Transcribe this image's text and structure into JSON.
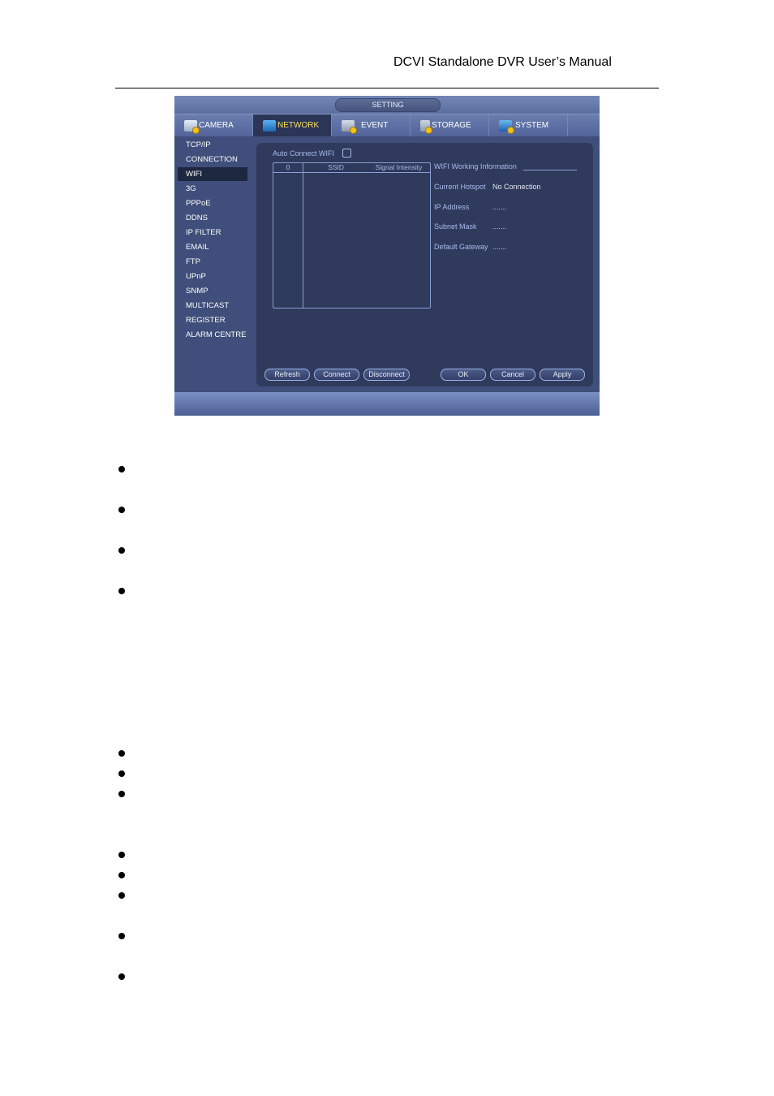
{
  "document": {
    "header": "DCVI Standalone DVR User’s Manual"
  },
  "window": {
    "title": "SETTING",
    "tabs": [
      {
        "label": "CAMERA",
        "icon": "camera-icon",
        "active": false
      },
      {
        "label": "NETWORK",
        "icon": "network-icon",
        "active": true
      },
      {
        "label": "EVENT",
        "icon": "event-icon",
        "active": false
      },
      {
        "label": "STORAGE",
        "icon": "storage-icon",
        "active": false
      },
      {
        "label": "SYSTEM",
        "icon": "system-icon",
        "active": false
      }
    ],
    "sidebar": {
      "items": [
        {
          "label": "TCP/IP"
        },
        {
          "label": "CONNECTION"
        },
        {
          "label": "WIFI",
          "active": true
        },
        {
          "label": "3G"
        },
        {
          "label": "PPPoE"
        },
        {
          "label": "DDNS"
        },
        {
          "label": "IP FILTER"
        },
        {
          "label": "EMAIL"
        },
        {
          "label": "FTP"
        },
        {
          "label": "UPnP"
        },
        {
          "label": "SNMP"
        },
        {
          "label": "MULTICAST"
        },
        {
          "label": "REGISTER"
        },
        {
          "label": "ALARM CENTRE"
        }
      ]
    },
    "wifi": {
      "auto_connect_label": "Auto Connect WIFI",
      "auto_connect_checked": false,
      "table": {
        "columns": [
          "0",
          "SSID",
          "Signal Intensity"
        ],
        "rows": []
      },
      "info": {
        "title": "WIFI Working Information",
        "current_hotspot_label": "Current Hotspot",
        "current_hotspot_value": "No Connection",
        "ip_address_label": "IP Address",
        "ip_address_value": ".......",
        "subnet_mask_label": "Subnet Mask",
        "subnet_mask_value": ".......",
        "default_gateway_label": "Default Gateway",
        "default_gateway_value": "......."
      },
      "buttons": {
        "refresh": "Refresh",
        "connect": "Connect",
        "disconnect": "Disconnect",
        "ok": "OK",
        "cancel": "Cancel",
        "apply": "Apply"
      }
    }
  },
  "colors": {
    "active_tab_text": "#f6e05a",
    "label_blue": "#a9bcee",
    "panel_bg": "#2f3a5c"
  }
}
